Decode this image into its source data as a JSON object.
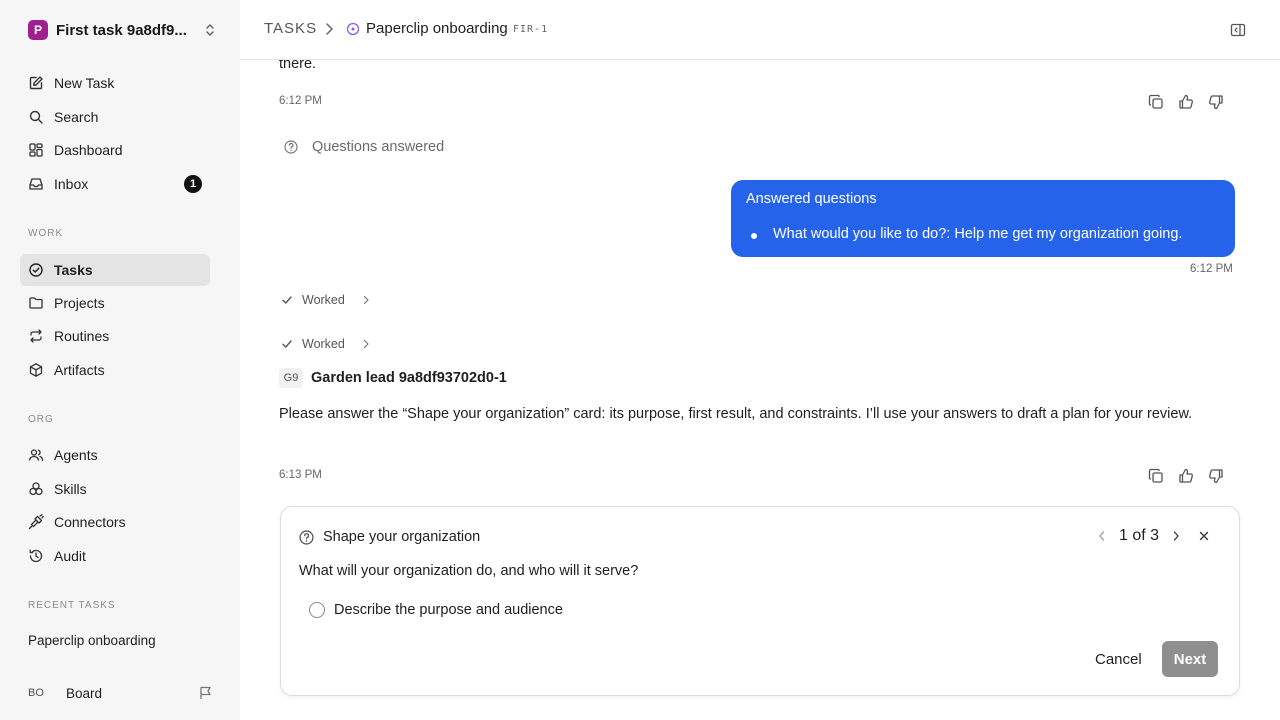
{
  "workspace": {
    "logo": "P",
    "name": "First task 9a8df9..."
  },
  "sidebar": {
    "new_task": "New Task",
    "search": "Search",
    "dashboard": "Dashboard",
    "inbox": "Inbox",
    "inbox_count": "1",
    "work_label": "WORK",
    "tasks": "Tasks",
    "projects": "Projects",
    "routines": "Routines",
    "artifacts": "Artifacts",
    "org_label": "ORG",
    "agents": "Agents",
    "skills": "Skills",
    "connectors": "Connectors",
    "audit": "Audit",
    "recent_label": "RECENT TASKS",
    "recent_item": "Paperclip onboarding",
    "board_initials": "BO",
    "board_name": "Board"
  },
  "header": {
    "root": "TASKS",
    "page": "Paperclip onboarding",
    "task_id": "FIR-1"
  },
  "feed": {
    "top_text": "there.",
    "time_1": "6:12 PM",
    "questions_answered": "Questions answered",
    "bubble_title": "Answered questions",
    "bubble_item": "What would you like to do?: Help me get my organization going.",
    "time_2": "6:12 PM",
    "worked_1": "Worked",
    "worked_2": "Worked",
    "agent_initials": "G9",
    "agent_name": "Garden lead 9a8df93702d0-1",
    "agent_message": "Please answer the “Shape your organization” card: its purpose, first result, and constraints. I’ll use your answers to draft a plan for your review.",
    "time_3": "6:13 PM"
  },
  "card": {
    "title": "Shape your organization",
    "pager": "1 of 3",
    "question": "What will your organization do, and who will it serve?",
    "option": "Describe the purpose and audience",
    "cancel": "Cancel",
    "next": "Next"
  },
  "colors": {
    "accent": "#2563eb",
    "workspace_logo": "#a1208f",
    "next_disabled": "#8f8f8f"
  },
  "icons": {
    "new_task": "pencil-square-icon",
    "search": "search-icon",
    "dashboard": "grid-icon",
    "inbox": "inbox-icon",
    "tasks": "check-circle-icon",
    "projects": "folder-icon",
    "routines": "repeat-icon",
    "artifacts": "box-icon",
    "agents": "users-icon",
    "skills": "atom-icon",
    "connectors": "plug-icon",
    "audit": "history-icon",
    "card_head": "help-circle-icon"
  }
}
